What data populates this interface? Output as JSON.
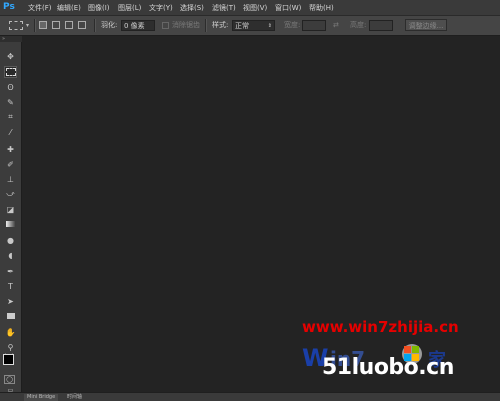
{
  "app": {
    "logo": "Ps"
  },
  "menu": {
    "items": [
      "文件(F)",
      "编辑(E)",
      "图像(I)",
      "图层(L)",
      "文字(Y)",
      "选择(S)",
      "滤镜(T)",
      "视图(V)",
      "窗口(W)",
      "帮助(H)"
    ]
  },
  "options": {
    "feather_label": "羽化:",
    "feather_value": "0 像素",
    "antialias_label": "消除锯齿",
    "style_label": "样式:",
    "style_value": "正常",
    "width_label": "宽度:",
    "height_label": "高度:",
    "refine_edge": "调整边缘..."
  },
  "status": {
    "tabs": [
      "Mini Bridge",
      "时间轴"
    ]
  },
  "watermark": {
    "line1": "www.win7zhijia.cn",
    "line2": "51luobo.cn"
  },
  "colors": {
    "accent": "#31a8ff",
    "watermark_red": "#e60000"
  }
}
